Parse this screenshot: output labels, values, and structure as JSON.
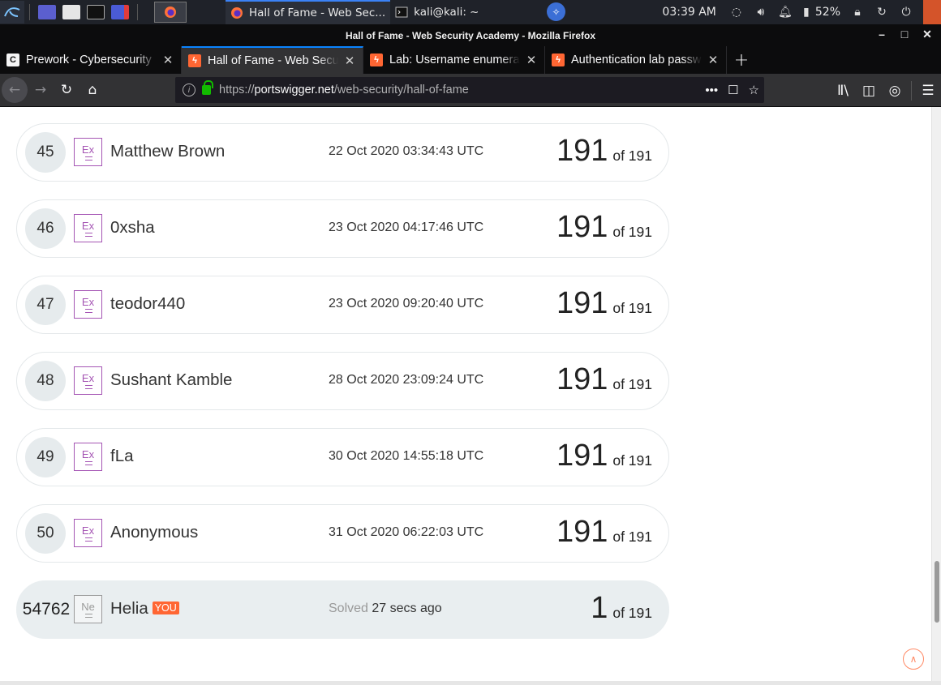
{
  "taskbar": {
    "tasks": [
      {
        "label": "Hall of Fame - Web Sec...",
        "active": true
      },
      {
        "label": "kali@kali: ~",
        "active": false
      }
    ],
    "clock": "03:39 AM",
    "battery": "52%"
  },
  "window": {
    "title": "Hall of Fame - Web Security Academy - Mozilla Firefox"
  },
  "tabs": [
    {
      "label": "Prework - Cybersecurity",
      "favicon": "C",
      "active": false
    },
    {
      "label": "Hall of Fame - Web Security Academy",
      "favicon": "ps",
      "active": true
    },
    {
      "label": "Lab: Username enumeration",
      "favicon": "ps",
      "active": false
    },
    {
      "label": "Authentication lab passwords",
      "favicon": "ps",
      "active": false
    }
  ],
  "url": {
    "scheme": "https://",
    "host": "portswigger.net",
    "path": "/web-security/hall-of-fame"
  },
  "leaderboard": [
    {
      "rank": "45",
      "badge": "Ex",
      "name": "Matthew Brown",
      "date": "22 Oct 2020 03:34:43 UTC",
      "score": "191",
      "of": "of 191"
    },
    {
      "rank": "46",
      "badge": "Ex",
      "name": "0xsha",
      "date": "23 Oct 2020 04:17:46 UTC",
      "score": "191",
      "of": "of 191"
    },
    {
      "rank": "47",
      "badge": "Ex",
      "name": "teodor440",
      "date": "23 Oct 2020 09:20:40 UTC",
      "score": "191",
      "of": "of 191"
    },
    {
      "rank": "48",
      "badge": "Ex",
      "name": "Sushant Kamble",
      "date": "28 Oct 2020 23:09:24 UTC",
      "score": "191",
      "of": "of 191"
    },
    {
      "rank": "49",
      "badge": "Ex",
      "name": "fLa",
      "date": "30 Oct 2020 14:55:18 UTC",
      "score": "191",
      "of": "of 191"
    },
    {
      "rank": "50",
      "badge": "Ex",
      "name": "Anonymous",
      "date": "31 Oct 2020 06:22:03 UTC",
      "score": "191",
      "of": "of 191"
    }
  ],
  "you_row": {
    "rank": "54762",
    "badge": "Ne",
    "name": "Helia",
    "you_tag": "YOU",
    "solved_prefix": "Solved",
    "solved_ago": "27 secs ago",
    "score": "1",
    "of": "of 191"
  },
  "colors": {
    "accent": "#ff6633",
    "expert_badge": "#a555b4",
    "row_highlight": "#e9eef0"
  }
}
